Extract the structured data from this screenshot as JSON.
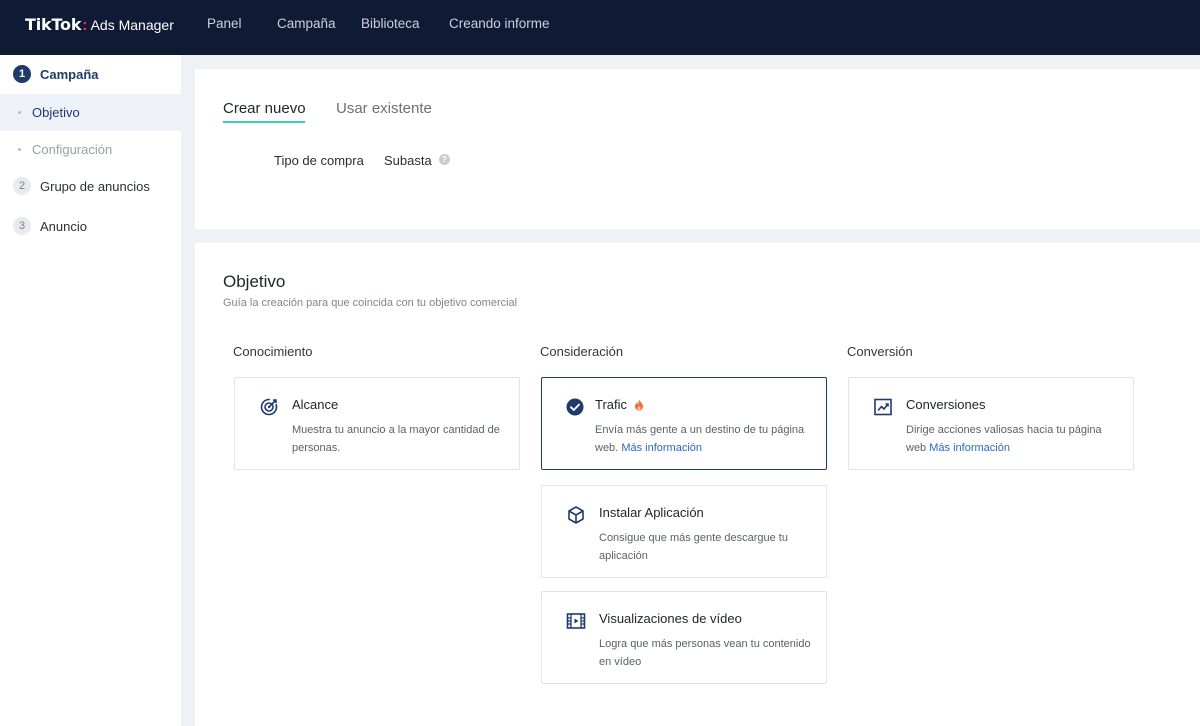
{
  "brand": {
    "name": "TikTok",
    "product": "Ads Manager"
  },
  "topnav": [
    "Panel",
    "Campaña",
    "Biblioteca",
    "Creando informe"
  ],
  "sidebar": {
    "steps": [
      {
        "num": "1",
        "label": "Campaña"
      },
      {
        "num": "2",
        "label": "Grupo de anuncios"
      },
      {
        "num": "3",
        "label": "Anuncio"
      }
    ],
    "substeps": [
      "Objetivo",
      "Configuración"
    ]
  },
  "setup": {
    "tabs": [
      "Crear nuevo",
      "Usar existente"
    ],
    "purchase_label": "Tipo de compra",
    "purchase_value": "Subasta"
  },
  "objective": {
    "title": "Objetivo",
    "subtitle": "Guía la creación para que coincida con tu objetivo comercial",
    "columns": [
      "Conocimiento",
      "Consideración",
      "Conversión"
    ],
    "cards": {
      "reach": {
        "title": "Alcance",
        "desc": "Muestra tu anuncio a la mayor cantidad de personas.",
        "icon": "target-icon"
      },
      "traffic": {
        "title": "Trafic",
        "desc": "Envía más gente a un destino de tu página web.",
        "link": "Más información",
        "icon": "check-circle-icon",
        "badge": "fire-icon"
      },
      "app_install": {
        "title": "Instalar Aplicación",
        "desc": "Consigue que más gente descargue tu aplicación",
        "icon": "cube-icon"
      },
      "video_views": {
        "title": "Visualizaciones de vídeo",
        "desc": "Logra que más personas vean tu contenido en vídeo",
        "icon": "film-icon"
      },
      "conversions": {
        "title": "Conversiones",
        "desc": "Dirige acciones valiosas hacia tu página web",
        "link": "Más información",
        "icon": "trend-chart-icon"
      }
    }
  },
  "colors": {
    "topbar": "#0f1a34",
    "accent": "#1f3b6e",
    "tab_underline": "#39c9c5",
    "link": "#2c69c4"
  }
}
